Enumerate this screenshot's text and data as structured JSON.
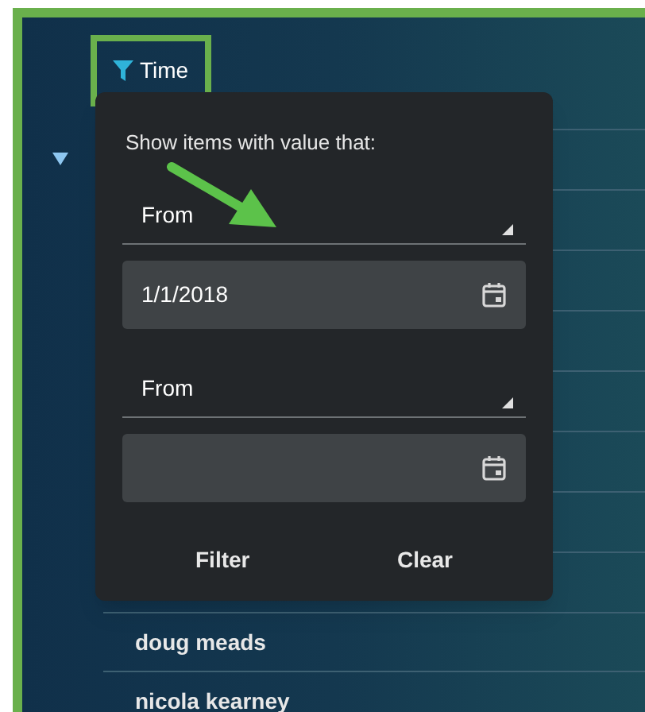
{
  "column_header": {
    "label": "Time",
    "filtered": true
  },
  "filter_popup": {
    "prompt": "Show items with value that:",
    "conditions": [
      {
        "operator": "From",
        "value": "1/1/2018"
      },
      {
        "operator": "From"
      }
    ],
    "buttons": [
      "Filter",
      "Clear"
    ]
  },
  "rows": [
    "doug meads",
    "nicola kearney"
  ]
}
